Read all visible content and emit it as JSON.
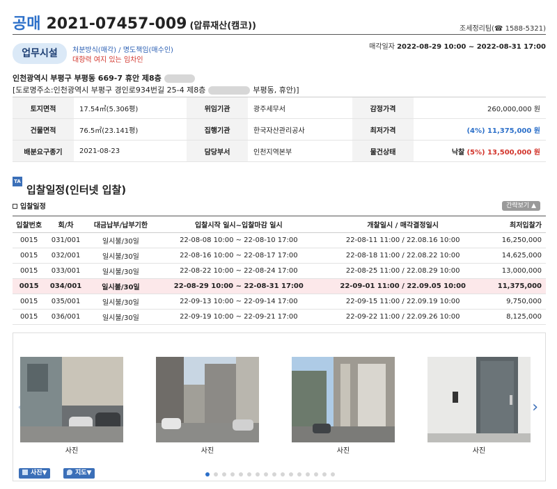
{
  "header": {
    "kind": "공매",
    "case_no": "2021-07457-009",
    "subtitle": "(압류재산(캠코))",
    "contact": "조세정리팀(☎ 1588-5321)"
  },
  "badge": "업무시설",
  "notes": {
    "line1": "처분방식(매각) / 명도책임(매수인)",
    "line2": "대항력 여지 있는 임차인"
  },
  "sale": {
    "label": "매각일자",
    "period": "2022-08-29 10:00 ~ 2022-08-31 17:00"
  },
  "address": {
    "lot_prefix": "인천광역시 부평구 부평동 669-7 휴안 제8층",
    "road_prefix": "[도로명주소:인천광역시 부평구 경인로934번길 25-4 제8층",
    "road_suffix": "부평동, 휴안)]"
  },
  "info": {
    "row1": {
      "l1": "토지면적",
      "v1": "17.54㎡(5.306평)",
      "l2": "위임기관",
      "v2": "광주세무서",
      "l3": "감정가격",
      "v3": "260,000,000 원"
    },
    "row2": {
      "l1": "건물면적",
      "v1": "76.5㎡(23.141평)",
      "l2": "집행기관",
      "v2": "한국자산관리공사",
      "l3": "최저가격",
      "v3": "(4%) 11,375,000 원"
    },
    "row3": {
      "l1": "배분요구종기",
      "v1": "2021-08-23",
      "l2": "담당부서",
      "v2": "인천지역본부",
      "l3": "물건상태",
      "v3_a": "낙찰",
      "v3_b": "(5%) 13,500,000 원"
    }
  },
  "schedule": {
    "icon_text": "TA NK",
    "title": "입찰일정(인터넷 입찰)",
    "sub_title": "입찰일정",
    "toggle": "간략보기 ▲",
    "headers": [
      "입찰번호",
      "회/차",
      "대금납부/납부기한",
      "입찰시작 일시~입찰마감 일시",
      "개찰일시 / 매각결정일시",
      "최저입찰가"
    ],
    "rows": [
      [
        "0015",
        "031/001",
        "일시불/30일",
        "22-08-08 10:00 ~ 22-08-10 17:00",
        "22-08-11 11:00 / 22.08.16 10:00",
        "16,250,000"
      ],
      [
        "0015",
        "032/001",
        "일시불/30일",
        "22-08-16 10:00 ~ 22-08-17 17:00",
        "22-08-18 11:00 / 22.08.22 10:00",
        "14,625,000"
      ],
      [
        "0015",
        "033/001",
        "일시불/30일",
        "22-08-22 10:00 ~ 22-08-24 17:00",
        "22-08-25 11:00 / 22.08.29 10:00",
        "13,000,000"
      ],
      [
        "0015",
        "034/001",
        "일시불/30일",
        "22-08-29 10:00 ~ 22-08-31 17:00",
        "22-09-01 11:00 / 22.09.05 10:00",
        "11,375,000"
      ],
      [
        "0015",
        "035/001",
        "일시불/30일",
        "22-09-13 10:00 ~ 22-09-14 17:00",
        "22-09-15 11:00 / 22.09.19 10:00",
        "9,750,000"
      ],
      [
        "0015",
        "036/001",
        "일시불/30일",
        "22-09-19 10:00 ~ 22-09-21 17:00",
        "22-09-22 11:00 / 22.09.26 10:00",
        "8,125,000"
      ]
    ]
  },
  "photos": {
    "captions": [
      "사진",
      "사진",
      "사진",
      "사진"
    ],
    "photo_btn": "사진▼",
    "map_btn": "지도▼",
    "page_count": 16,
    "active_page": 1
  }
}
